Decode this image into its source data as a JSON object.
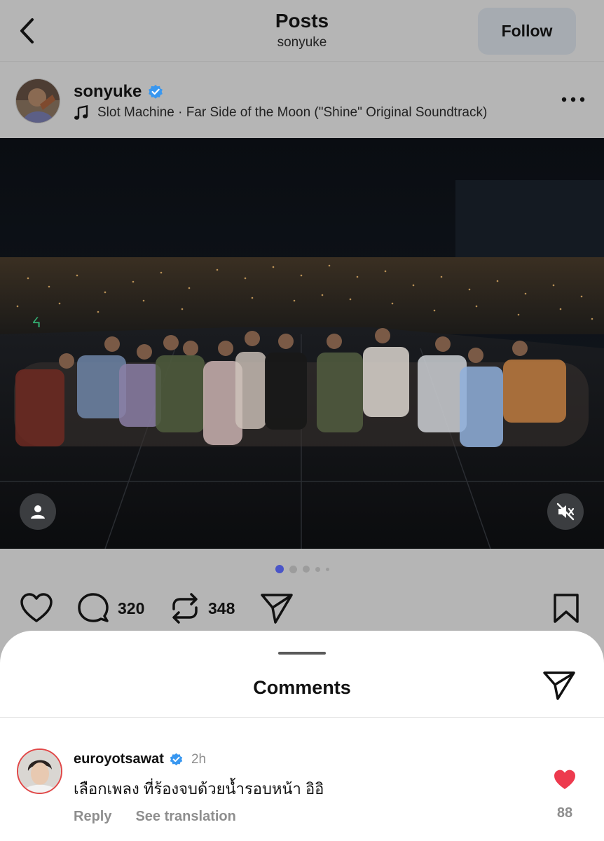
{
  "header": {
    "title": "Posts",
    "subtitle": "sonyuke",
    "follow_label": "Follow",
    "back_icon": "chevron-left-icon"
  },
  "post": {
    "username": "sonyuke",
    "verified": true,
    "music_icon": "music-note-icon",
    "music_text": "Slot Machine · Far Side of the Moon (\"Shine\" Original Soundtrack)",
    "more_icon": "more-horizontal-icon",
    "carousel": {
      "total": 5,
      "active_index": 0
    },
    "likes_icon": "heart-outline-icon",
    "comment_count": "320",
    "repost_count": "348"
  },
  "comments_sheet": {
    "title": "Comments",
    "share_icon": "send-icon",
    "comments": [
      {
        "username": "euroyotsawat",
        "verified": true,
        "time": "2h",
        "text": "เลือกเพลง ที่ร้องจบด้วยน้ำรอบหน้า อิอิ",
        "reply_label": "Reply",
        "translate_label": "See translation",
        "like_count": "88",
        "liked": true
      }
    ]
  },
  "colors": {
    "overlay_bg": "#b5b5b5",
    "verified_blue": "#3897f0",
    "like_red": "#ed3a4e",
    "active_dot": "#4a55c8"
  }
}
